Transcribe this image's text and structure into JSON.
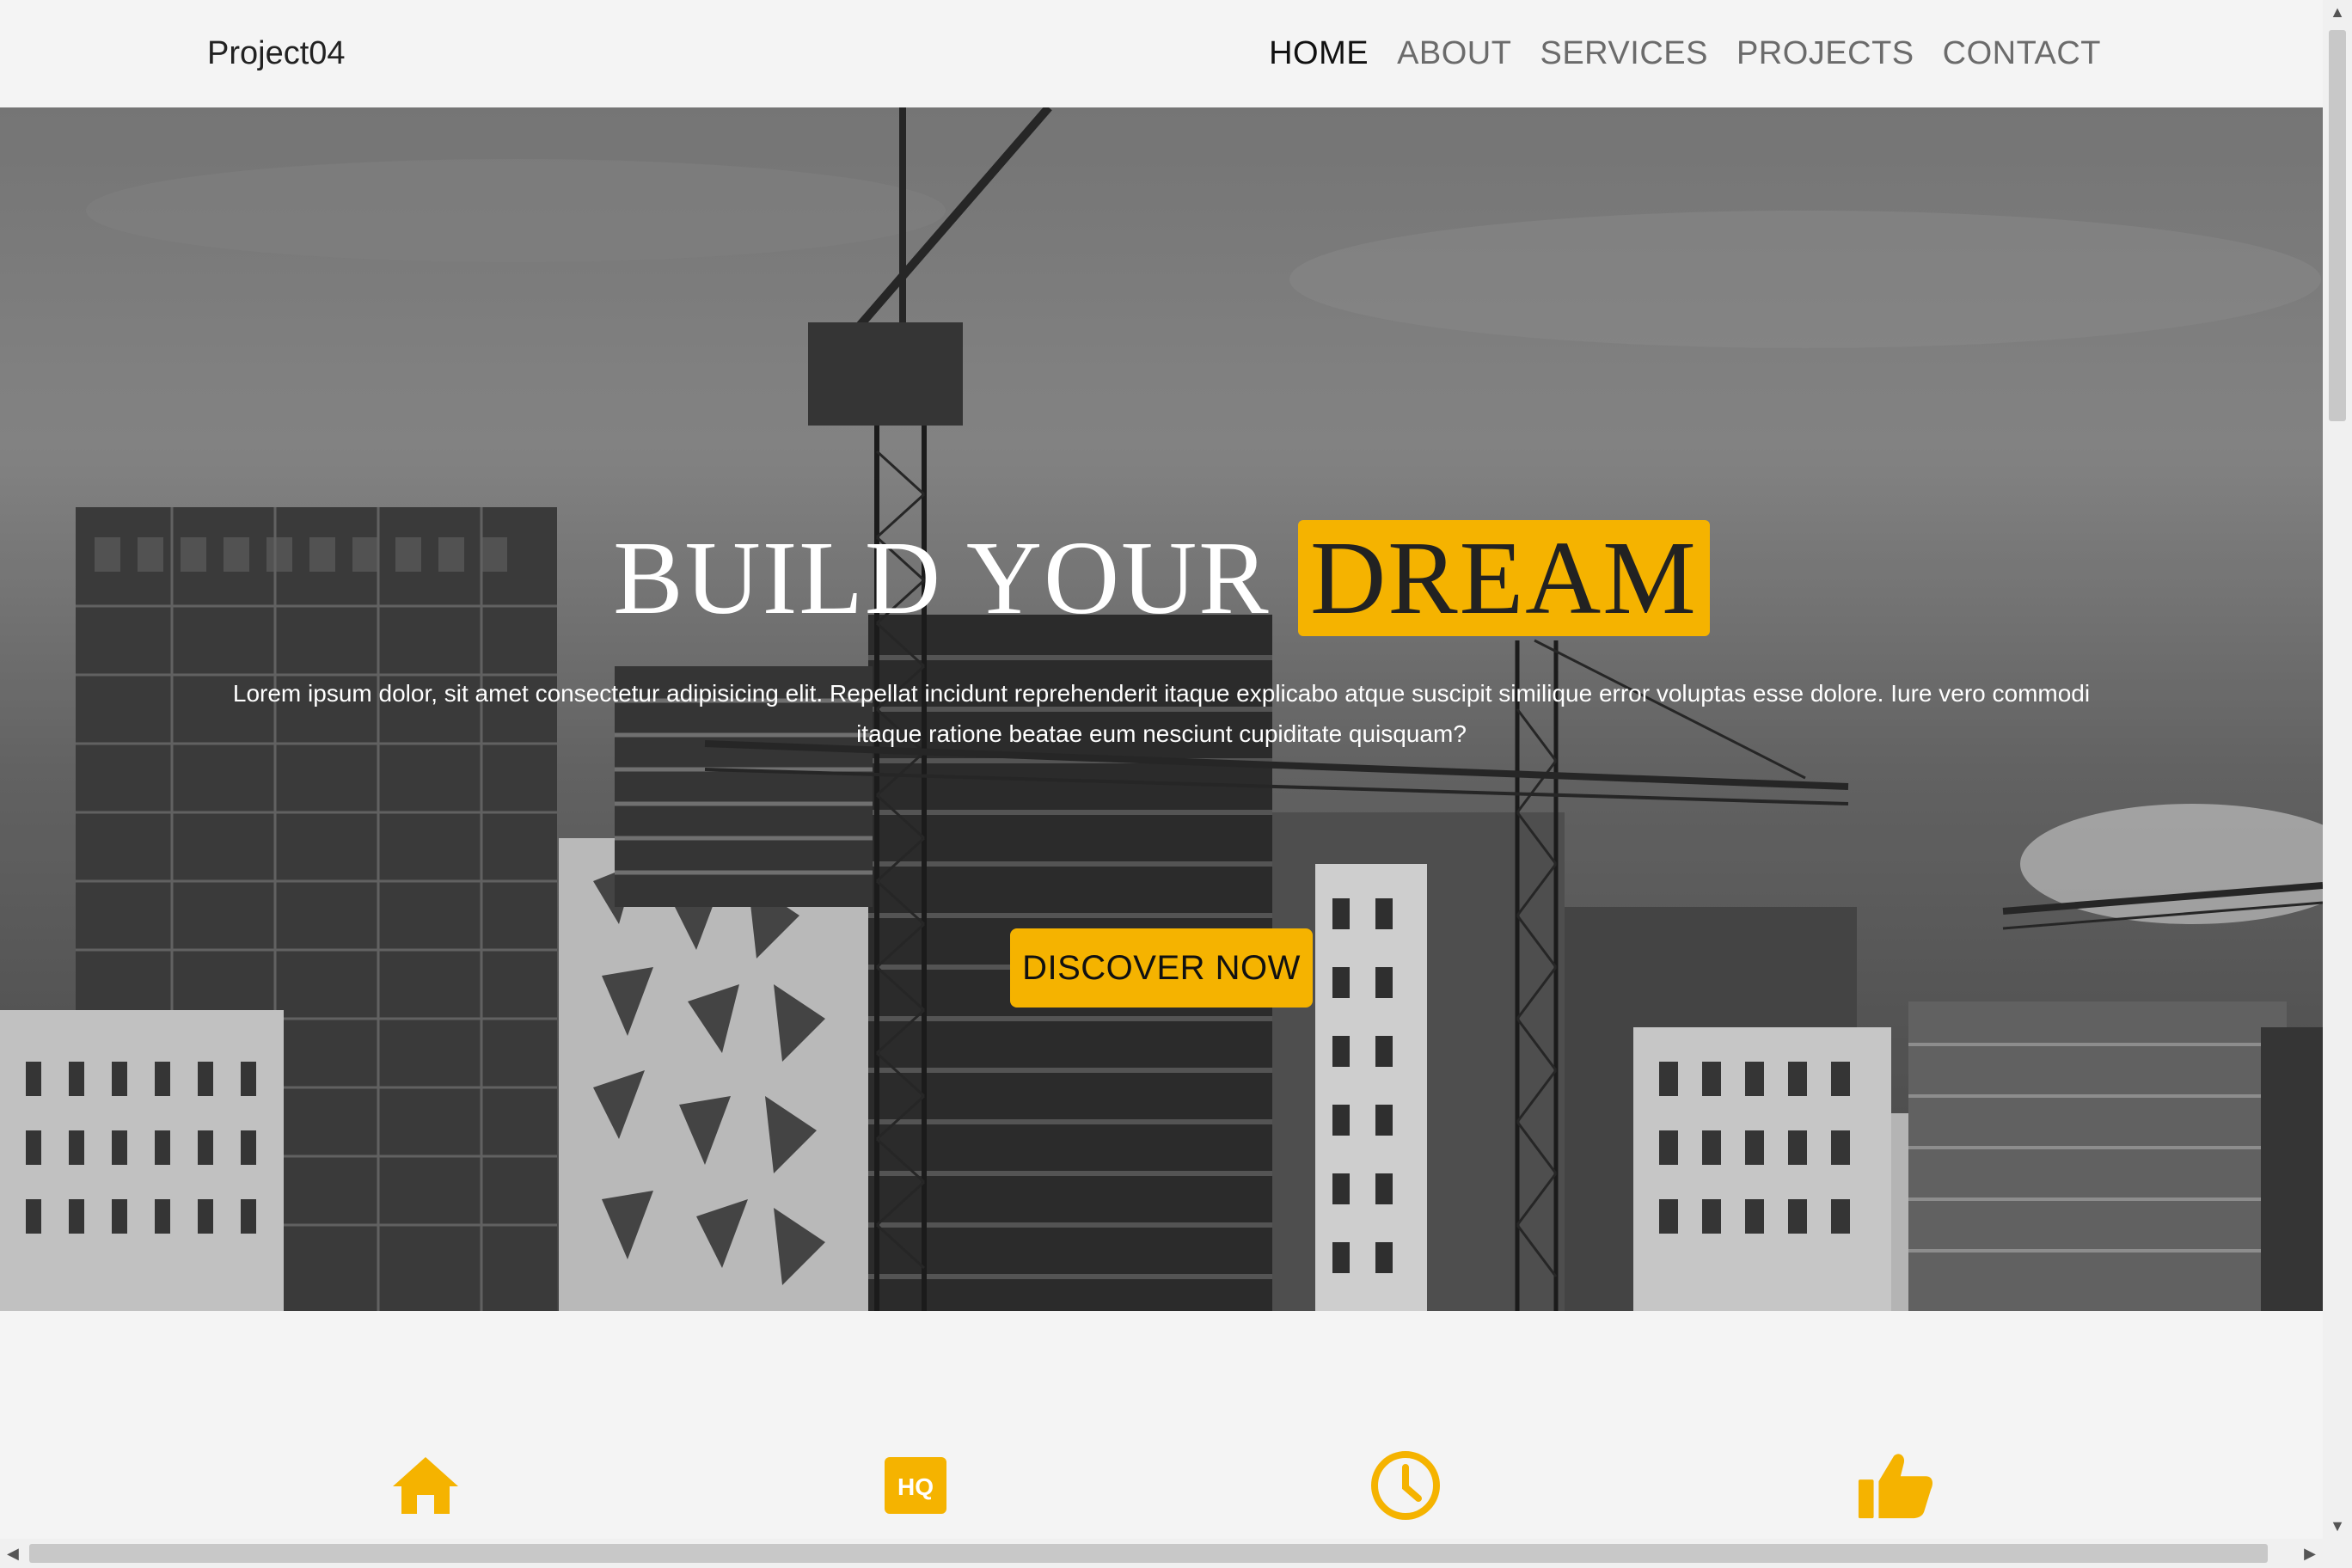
{
  "brand": "Project04",
  "nav": [
    {
      "label": "HOME",
      "active": true
    },
    {
      "label": "ABOUT",
      "active": false
    },
    {
      "label": "SERVICES",
      "active": false
    },
    {
      "label": "PROJECTS",
      "active": false
    },
    {
      "label": "CONTACT",
      "active": false
    }
  ],
  "hero": {
    "title_main": "BUILD YOUR",
    "title_highlight": "DREAM",
    "text": "Lorem ipsum dolor, sit amet consectetur adipisicing elit. Repellat incidunt reprehenderit itaque explicabo atque suscipit similique error voluptas esse dolore. Iure vero commodi itaque ratione beatae eum nesciunt cupiditate quisquam?",
    "cta": "DISCOVER NOW"
  },
  "features": {
    "icons": [
      "home-icon",
      "hq-icon",
      "clock-icon",
      "thumbs-up-icon"
    ],
    "hq_glyph": "HQ"
  },
  "colors": {
    "accent": "#f5b300",
    "background": "#f4f4f4",
    "nav_active": "#111111",
    "nav_inactive": "#6b6b6b"
  }
}
